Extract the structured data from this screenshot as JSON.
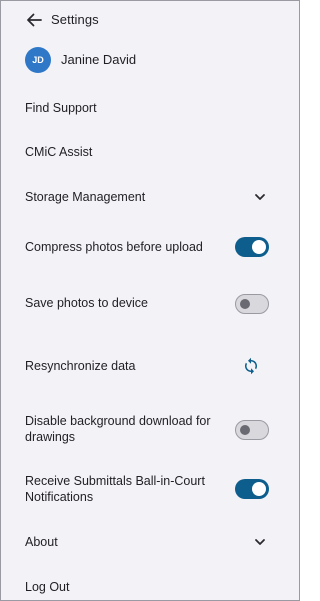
{
  "header": {
    "title": "Settings",
    "back_icon": "arrow-left-icon"
  },
  "user": {
    "initials": "JD",
    "name": "Janine David",
    "avatar_color": "#2f78c8"
  },
  "menu": {
    "find_support": "Find Support",
    "cmic_assist": "CMiC Assist",
    "storage_management": "Storage Management",
    "compress_photos": "Compress photos before upload",
    "save_photos": "Save photos to device",
    "resynchronize": "Resynchronize data",
    "disable_background_download": "Disable background download for drawings",
    "receive_submittals": "Receive Submittals Ball-in-Court Notifications",
    "about": "About",
    "log_out": "Log Out"
  },
  "toggles": {
    "compress_photos": true,
    "save_photos": false,
    "disable_background_download": false,
    "receive_submittals": true
  },
  "colors": {
    "toggle_on": "#0d5e8c",
    "accent": "#0d5e8c",
    "background": "#f3f2f6"
  }
}
